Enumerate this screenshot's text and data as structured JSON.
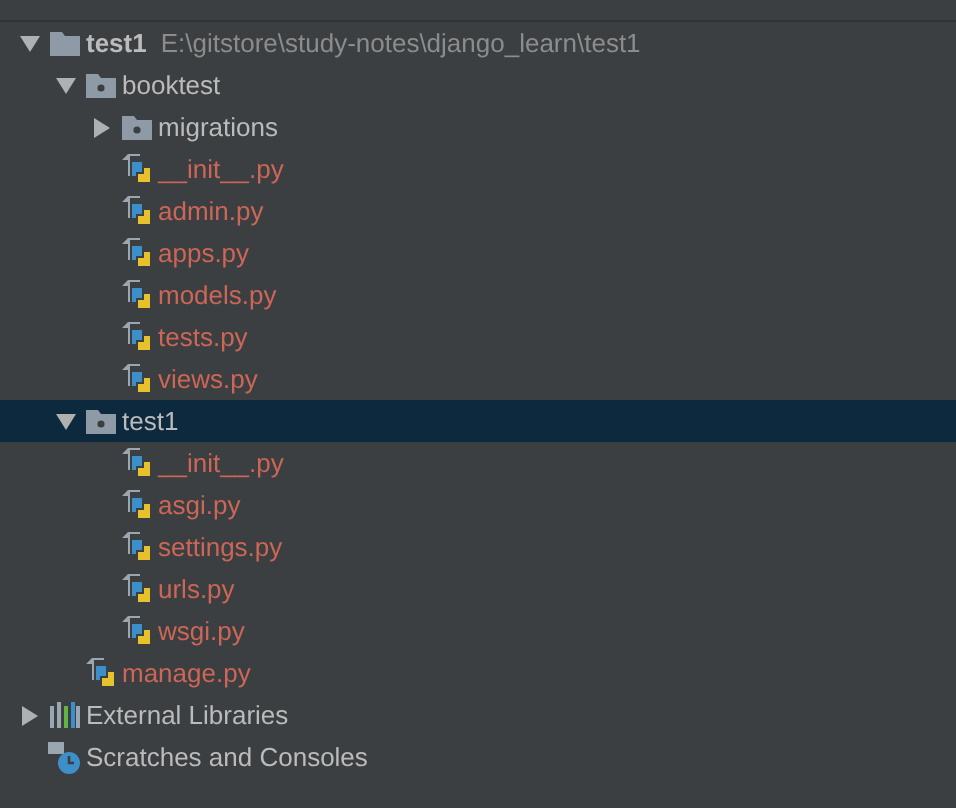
{
  "tree": [
    {
      "name": "test1",
      "kind": "project",
      "path": "E:\\gitstore\\study-notes\\django_learn\\test1",
      "expanded": true,
      "selected": false,
      "children": [
        {
          "name": "booktest",
          "kind": "package",
          "expanded": true,
          "selected": false,
          "children": [
            {
              "name": "migrations",
              "kind": "package",
              "expanded": false,
              "selected": false
            },
            {
              "name": "__init__.py",
              "kind": "file",
              "untracked": true,
              "selected": false
            },
            {
              "name": "admin.py",
              "kind": "file",
              "untracked": true,
              "selected": false
            },
            {
              "name": "apps.py",
              "kind": "file",
              "untracked": true,
              "selected": false
            },
            {
              "name": "models.py",
              "kind": "file",
              "untracked": true,
              "selected": false
            },
            {
              "name": "tests.py",
              "kind": "file",
              "untracked": true,
              "selected": false
            },
            {
              "name": "views.py",
              "kind": "file",
              "untracked": true,
              "selected": false
            }
          ]
        },
        {
          "name": "test1",
          "kind": "package",
          "expanded": true,
          "selected": true,
          "children": [
            {
              "name": "__init__.py",
              "kind": "file",
              "untracked": true,
              "selected": false
            },
            {
              "name": "asgi.py",
              "kind": "file",
              "untracked": true,
              "selected": false
            },
            {
              "name": "settings.py",
              "kind": "file",
              "untracked": true,
              "selected": false
            },
            {
              "name": "urls.py",
              "kind": "file",
              "untracked": true,
              "selected": false
            },
            {
              "name": "wsgi.py",
              "kind": "file",
              "untracked": true,
              "selected": false
            }
          ]
        },
        {
          "name": "manage.py",
          "kind": "file",
          "untracked": true,
          "selected": false
        }
      ]
    },
    {
      "name": "External Libraries",
      "kind": "libraries",
      "expanded": false,
      "selected": false
    },
    {
      "name": "Scratches and Consoles",
      "kind": "scratches",
      "selected": false
    }
  ]
}
